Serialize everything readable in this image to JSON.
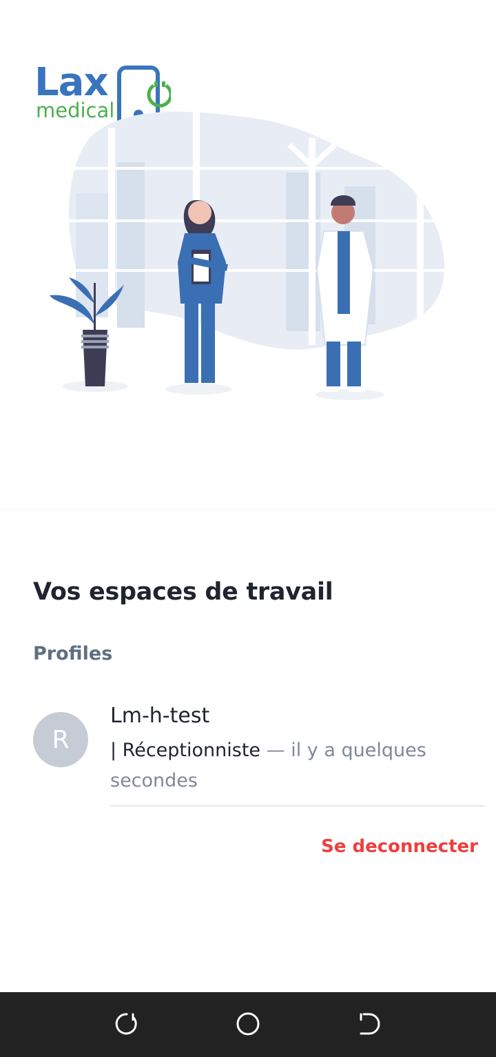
{
  "brand": {
    "name_primary": "Lax",
    "name_secondary": "medical",
    "colors": {
      "primary": "#3a74bd",
      "secondary": "#4caf50"
    }
  },
  "illustration": {
    "icon": "doctors-illustration"
  },
  "workspaces": {
    "title": "Vos espaces de travail",
    "section_label": "Profiles",
    "profiles": [
      {
        "avatar_initial": "R",
        "name": "Lm-h-test",
        "role": "| Réceptionniste",
        "time": "— il y a quelques secondes"
      }
    ]
  },
  "actions": {
    "logout_label": "Se deconnecter",
    "logout_color": "#f03e3e"
  },
  "system_nav": {
    "buttons": [
      "recent-apps-icon",
      "home-icon",
      "back-icon"
    ]
  }
}
